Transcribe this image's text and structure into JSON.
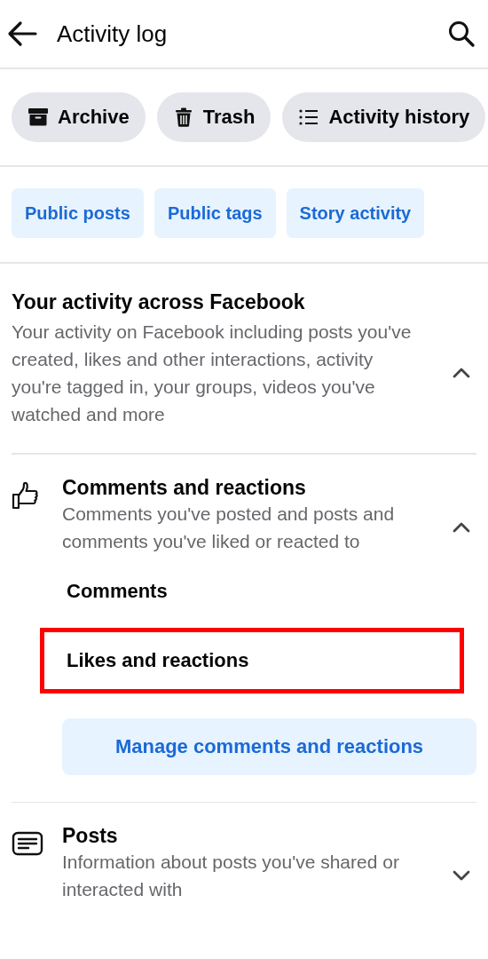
{
  "header": {
    "title": "Activity log"
  },
  "actions": [
    {
      "label": "Archive",
      "kind": "archive"
    },
    {
      "label": "Trash",
      "kind": "trash"
    },
    {
      "label": "Activity history",
      "kind": "list"
    }
  ],
  "filters": [
    "Public posts",
    "Public tags",
    "Story activity"
  ],
  "overview": {
    "title": "Your activity across Facebook",
    "description": "Your activity on Facebook including posts you've created, likes and other interactions, activity you're tagged in, your groups, videos you've watched and more",
    "expanded": true
  },
  "categories": [
    {
      "kind": "like",
      "title": "Comments and reactions",
      "description": "Comments you've posted and posts and comments you've liked or reacted to",
      "expanded": true,
      "items": [
        {
          "label": "Comments",
          "highlighted": false
        },
        {
          "label": "Likes and reactions",
          "highlighted": true
        }
      ],
      "manage_button": "Manage comments and reactions"
    },
    {
      "kind": "post",
      "title": "Posts",
      "description": "Information about posts you've shared or interacted with",
      "expanded": false
    }
  ]
}
